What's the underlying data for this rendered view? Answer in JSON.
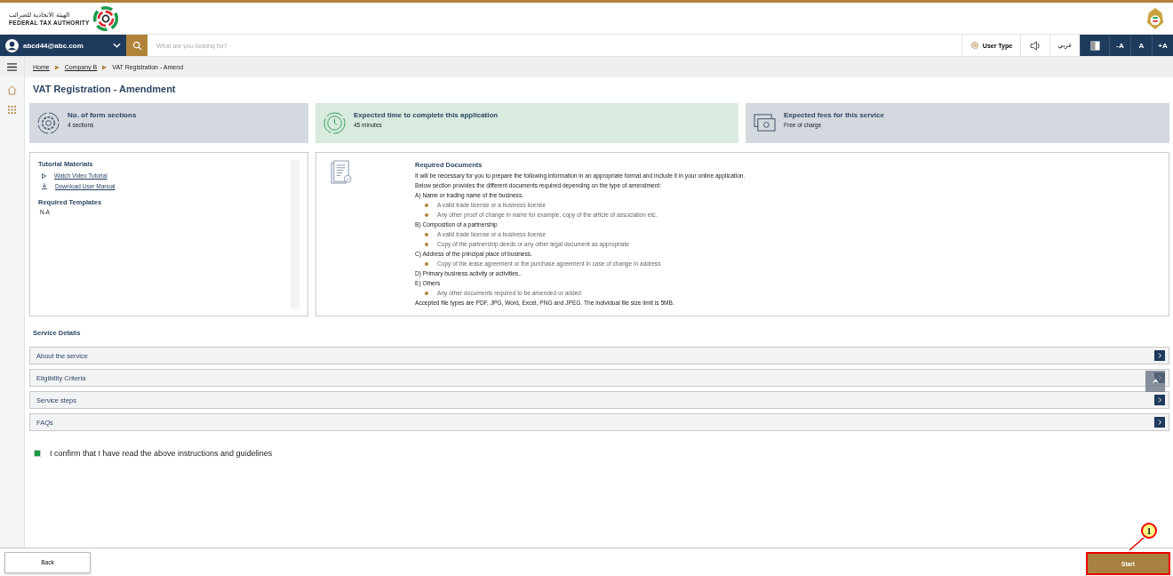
{
  "header": {
    "logo_arabic": "الهيئة الاتحادية للضرائب",
    "logo_english": "FEDERAL TAX AUTHORITY"
  },
  "nav": {
    "user_email": "abcd44@abc.com",
    "search_placeholder": "What are you looking for?",
    "user_type": "User Type",
    "language": "عربي",
    "font_buttons": [
      "-A",
      "A",
      "+A"
    ]
  },
  "breadcrumb": [
    {
      "label": "Home",
      "link": true
    },
    {
      "label": "Company B",
      "link": true
    },
    {
      "label": "VAT Registration - Amend",
      "link": false
    }
  ],
  "page_title": "VAT Registration - Amendment",
  "info_cards": [
    {
      "kind": "sections",
      "title": "No. of form sections",
      "value": "4 sections"
    },
    {
      "kind": "time",
      "title": "Expected time to complete this application",
      "value": "45 minutes"
    },
    {
      "kind": "fees",
      "title": "Expected fees for this service",
      "value": "Free of charge"
    }
  ],
  "tutorial": {
    "title": "Tutorial Materials",
    "links": [
      {
        "kind": "video",
        "label": "Watch Video Tutorial"
      },
      {
        "kind": "download",
        "label": "Download User Manual"
      }
    ],
    "templates_title": "Required Templates",
    "templates_value": "N.A"
  },
  "required_documents": {
    "title": "Required Documents",
    "lines": [
      {
        "kind": "text",
        "text": "It will be necessary for you to prepare the following information in an appropriate format and include it in your online application."
      },
      {
        "kind": "text",
        "text": "Below section provides the different documents required depending on the type of amendment:"
      },
      {
        "kind": "text",
        "text": "A) Name or trading name of the business."
      },
      {
        "kind": "bullet",
        "text": "A valid trade license or a business license"
      },
      {
        "kind": "bullet",
        "text": "Any other proof of change in name for example, copy of the article of association etc."
      },
      {
        "kind": "text",
        "text": "B) Composition of a partnership"
      },
      {
        "kind": "bullet",
        "text": "A valid trade license or a business license"
      },
      {
        "kind": "bullet",
        "text": "Copy of the partnership deeds or any other legal document as appropriate"
      },
      {
        "kind": "text",
        "text": "C) Address of the principal place of business."
      },
      {
        "kind": "bullet",
        "text": "Copy of the lease agreement or the purchase agreement in case of change in address"
      },
      {
        "kind": "text",
        "text": "D) Primary business activity or activities.."
      },
      {
        "kind": "text",
        "text": "E) Others"
      },
      {
        "kind": "bullet",
        "text": "Any other documents required to be amended or added"
      },
      {
        "kind": "text",
        "text": "Accepted file types are PDF, JPG, Word, Excel, PNG and JPEG. The individual file size limit is 5MB."
      }
    ]
  },
  "service_details": {
    "title": "Service Details",
    "sections": [
      {
        "label": "About the service",
        "expanded": false
      },
      {
        "label": "Eligibility Criteria",
        "expanded": false
      },
      {
        "label": "Service steps",
        "expanded": false
      },
      {
        "label": "FAQs",
        "expanded": false
      }
    ]
  },
  "confirm": {
    "label": "I confirm that I have read the above instructions and guidelines",
    "checked": true
  },
  "footer": {
    "back": "Back",
    "start": "Start"
  },
  "callout": {
    "number": "1"
  }
}
